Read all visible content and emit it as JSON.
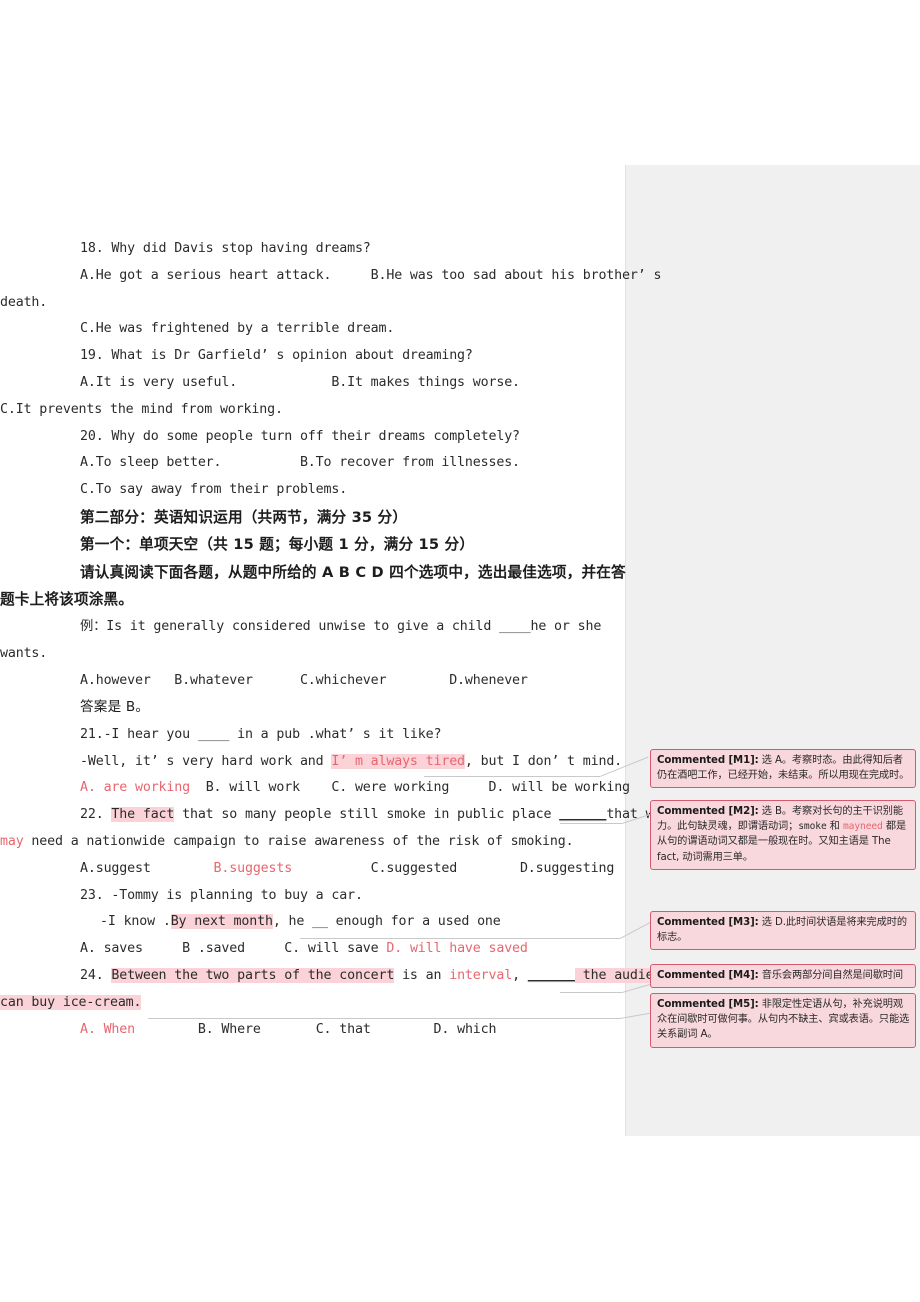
{
  "document": {
    "lines": [
      {
        "id": "q18",
        "type": "en",
        "indent": "in",
        "text": "18. Why did Davis stop having dreams?"
      },
      {
        "id": "q18-ab",
        "type": "en",
        "indent": "in",
        "text": "A.He got a serious heart attack.     B.He was too sad about his brother’ s"
      },
      {
        "id": "q18-ab2",
        "type": "en",
        "indent": "out",
        "text": "death."
      },
      {
        "id": "q18-c",
        "type": "en",
        "indent": "in",
        "text": "C.He was frightened by a terrible dream."
      },
      {
        "id": "q19",
        "type": "en",
        "indent": "in",
        "text": "19. What is Dr Garfield’ s opinion about dreaming?"
      },
      {
        "id": "q19-ab",
        "type": "en",
        "indent": "in",
        "text": "A.It is very useful.            B.It makes things worse."
      },
      {
        "id": "q19-c",
        "type": "en",
        "indent": "out",
        "text": "C.It prevents the mind from working."
      },
      {
        "id": "q20",
        "type": "en",
        "indent": "in",
        "text": "20. Why do some people turn off their dreams completely?"
      },
      {
        "id": "q20-ab",
        "type": "en",
        "indent": "in",
        "text": "A.To sleep better.          B.To recover from illnesses."
      },
      {
        "id": "q20-c",
        "type": "en",
        "indent": "in",
        "text": "C.To say away from their problems."
      },
      {
        "id": "part2",
        "type": "cn",
        "indent": "in",
        "text": "第二部分：英语知识运用（共两节，满分 35 分）"
      },
      {
        "id": "sect1",
        "type": "cn",
        "indent": "in",
        "text": "第一个：单项天空（共 15 题；每小题 1 分，满分 15 分）"
      },
      {
        "id": "instr1",
        "type": "cn",
        "indent": "in",
        "text": "请认真阅读下面各题，从题中所给的 A B C D 四个选项中，选出最佳选项，并在答"
      },
      {
        "id": "instr2",
        "type": "cn",
        "indent": "out",
        "text": "题卡上将该项涂黑。"
      },
      {
        "id": "ex1",
        "type": "en",
        "indent": "in",
        "text": "例：Is it generally considered unwise to give a child ____he or she"
      },
      {
        "id": "ex2",
        "type": "en",
        "indent": "out",
        "text": "wants."
      },
      {
        "id": "ex-opts",
        "type": "en",
        "indent": "in",
        "text": "A.however   B.whatever      C.whichever        D.whenever"
      },
      {
        "id": "ex-ans",
        "type": "cn",
        "indent": "in",
        "text": "答案是 B。",
        "weight": "normal"
      },
      {
        "id": "q21",
        "type": "en",
        "indent": "in",
        "text": "21.-I hear you ____ in a pub .what’ s it like?"
      }
    ],
    "q21_reply": {
      "prefix": "-Well, it’ s very hard work and ",
      "highlight": "I’ m always tired",
      "suffix": ", but I don’ t mind."
    },
    "q21_options": {
      "a": "A. are working",
      "b": "B. will work",
      "c": "C. were working",
      "d": "D. will be working"
    },
    "q22_stem": {
      "number": "22. ",
      "highlight": "The fact",
      "mid": " that so many people still smoke in public place ",
      "blank": "______",
      "tail": "that we",
      "line2_red": "may",
      "line2_rest": " need a nationwide campaign to raise awareness of the risk of smoking."
    },
    "q22_options": {
      "a": "A.suggest",
      "b": "B.suggests",
      "c": "C.suggested",
      "d": "D.suggesting"
    },
    "q23_stem_1": "23. -Tommy is planning to buy a car.",
    "q23_stem_2": {
      "prefix": "-I know .",
      "highlight": "By next month",
      "suffix": ", he __ enough for a used one"
    },
    "q23_options": {
      "a": "A. saves",
      "b": "B .saved",
      "c": "C. will save",
      "d": "D. will have saved"
    },
    "q24_stem": {
      "number": "24. ",
      "highlight1": "Between the two parts of the concert",
      "mid1": " is an ",
      "red1": "interval",
      "mid2": ", ",
      "blank": "______",
      "highlight2": " the audience",
      "line2": "can buy ice-cream."
    },
    "q24_options": {
      "a": "A. When",
      "b": "B. Where",
      "c": "C. that",
      "d": "D. which"
    }
  },
  "comments": [
    {
      "id": "m1",
      "tag": "Commented [M1]:",
      "body": " 选 A。考察时态。由此得知后者仍在酒吧工作，已经开始，未结束。所以用现在完成时。"
    },
    {
      "id": "m2",
      "tag": "Commented [M2]:",
      "body_a": " 选 B。考察对长句的主干识别能力。此句缺灵魂，即谓语动词；",
      "body_mono": "smoke",
      "body_b": " 和 ",
      "body_red": "mayneed",
      "body_c": " 都是从句的谓语动词又都是一般现在时。又知主语是 The fact, 动词需用三单。"
    },
    {
      "id": "m3",
      "tag": "Commented [M3]:",
      "body": " 选 D.此时间状语是将来完成时的标志。"
    },
    {
      "id": "m4",
      "tag": "Commented [M4]:",
      "body": " 音乐会两部分间自然是间歇时间"
    },
    {
      "id": "m5",
      "tag": "Commented [M5]:",
      "body": " 非限定性定语从句，补充说明观众在间歇时可做何事。从句内不缺主、宾或表语。只能选关系副词 A。"
    }
  ],
  "colors": {
    "highlight_bg": "#fbd2d8",
    "annotation_red": "#e8666f",
    "comment_bg": "#f8d7dd",
    "comment_border": "#d4586e",
    "margin_panel": "#f0f0f0",
    "body_text": "#2b2b2b"
  }
}
